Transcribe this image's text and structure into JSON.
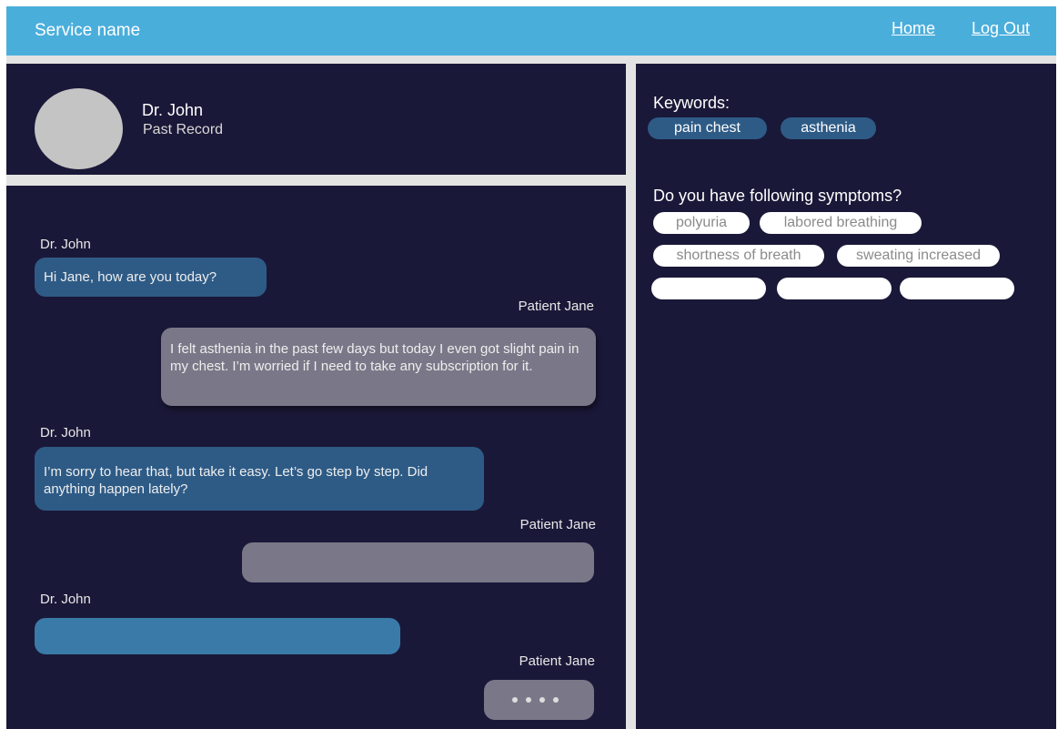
{
  "header": {
    "service_name": "Service name",
    "nav": {
      "home": "Home",
      "logout": "Log Out"
    }
  },
  "profile": {
    "doctor_name": "Dr. John",
    "past_record": "Past Record"
  },
  "chat": {
    "messages": [
      {
        "sender": "Dr. John",
        "text": "Hi Jane, how are you today?"
      },
      {
        "sender": "Patient Jane",
        "text": "I felt asthenia in the past few days but today I even got slight pain in my chest. I’m worried if I need to take any subscription for it."
      },
      {
        "sender": "Dr. John",
        "text": "I’m sorry to hear that, but take it easy. Let’s go step by step. Did anything happen lately?"
      },
      {
        "sender": "Patient Jane",
        "text": ""
      },
      {
        "sender": "Dr. John",
        "text": ""
      },
      {
        "sender": "Patient Jane",
        "text": ""
      }
    ]
  },
  "sidebar": {
    "keywords_title": "Keywords:",
    "keywords": [
      "pain chest",
      "asthenia"
    ],
    "symptoms_title": "Do you have following symptoms?",
    "symptoms": [
      "polyuria",
      "labored breathing",
      "shortness of breath",
      "sweating increased",
      "",
      "",
      ""
    ]
  },
  "colors": {
    "header": "#4aaedb",
    "panel": "#1a1838",
    "doctor_bubble": "#2e5b86",
    "patient_bubble": "#7a7888",
    "keyword_chip": "#2e5b86"
  }
}
